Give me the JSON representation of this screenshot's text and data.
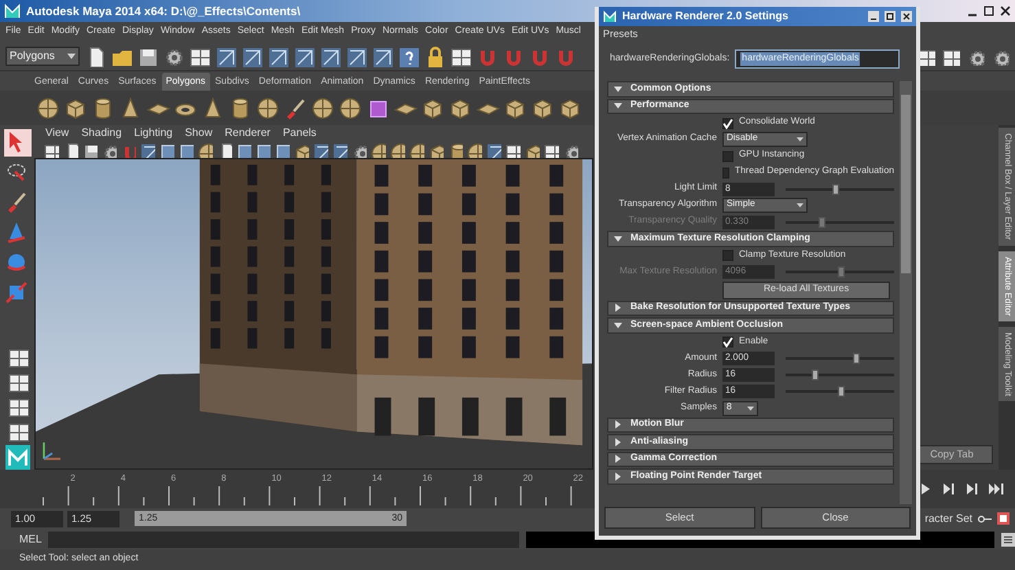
{
  "main_window": {
    "title": "Autodesk Maya 2014 x64: D:\\@_Effects\\Contents\\"
  },
  "menu_bar": [
    "File",
    "Edit",
    "Modify",
    "Create",
    "Display",
    "Window",
    "Assets",
    "Select",
    "Mesh",
    "Edit Mesh",
    "Proxy",
    "Normals",
    "Color",
    "Create UVs",
    "Edit UVs",
    "Muscl"
  ],
  "status_line": {
    "menu_set": "Polygons"
  },
  "shelf": {
    "tabs": [
      {
        "label": "General",
        "selected": false
      },
      {
        "label": "Curves",
        "selected": false
      },
      {
        "label": "Surfaces",
        "selected": false
      },
      {
        "label": "Polygons",
        "selected": true
      },
      {
        "label": "Subdivs",
        "selected": false
      },
      {
        "label": "Deformation",
        "selected": false
      },
      {
        "label": "Animation",
        "selected": false
      },
      {
        "label": "Dynamics",
        "selected": false
      },
      {
        "label": "Rendering",
        "selected": false
      },
      {
        "label": "PaintEffects",
        "selected": false
      }
    ]
  },
  "viewport_panel": {
    "menus": [
      "View",
      "Shading",
      "Lighting",
      "Show",
      "Renderer",
      "Panels"
    ]
  },
  "side_panel": {
    "tabs": [
      {
        "label": "Channel Box / Layer Editor",
        "selected": false
      },
      {
        "label": "Attribute Editor",
        "selected": true
      },
      {
        "label": "Modeling Toolkit",
        "selected": false
      }
    ],
    "copy_tab_button": "Copy Tab"
  },
  "time_slider": {
    "ticks": [
      "2",
      "4",
      "6",
      "8",
      "10",
      "12",
      "14",
      "16",
      "18",
      "20",
      "22"
    ]
  },
  "range_slider": {
    "start": "1.00",
    "playback_start": "1.25",
    "bar_start": "1.25",
    "bar_end": "30",
    "character_set_label": "racter Set"
  },
  "command_line": {
    "label": "MEL"
  },
  "help_line": "Select Tool: select an object",
  "dialog": {
    "title": "Hardware Renderer 2.0 Settings",
    "menus": [
      "Presets"
    ],
    "node_label": "hardwareRenderingGlobals:",
    "node_value": "hardwareRenderingGlobals",
    "sections": [
      {
        "title": "Common Options",
        "expanded": true
      },
      {
        "title": "Performance",
        "expanded": true,
        "rows": [
          {
            "kind": "checkbox",
            "label": "Consolidate World",
            "checked": true
          },
          {
            "kind": "dropdown",
            "label": "Vertex Animation Cache",
            "value": "Disable"
          },
          {
            "kind": "checkbox",
            "label": "GPU Instancing",
            "checked": false
          },
          {
            "kind": "checkbox",
            "label": "Thread Dependency Graph Evaluation",
            "checked": false
          },
          {
            "kind": "slider",
            "label": "Light Limit",
            "value": "8",
            "level": 0.45,
            "disabled": false
          },
          {
            "kind": "dropdown",
            "label": "Transparency Algorithm",
            "value": "Simple"
          },
          {
            "kind": "slider",
            "label": "Transparency Quality",
            "value": "0.330",
            "level": 0.33,
            "disabled": true
          }
        ]
      },
      {
        "title": "Maximum Texture Resolution Clamping",
        "expanded": true,
        "rows": [
          {
            "kind": "checkbox",
            "label": "Clamp Texture Resolution",
            "checked": false
          },
          {
            "kind": "slider",
            "label": "Max Texture Resolution",
            "value": "4096",
            "level": 0.5,
            "disabled": true
          },
          {
            "kind": "button",
            "label": "Re-load All Textures"
          }
        ]
      },
      {
        "title": "Bake Resolution for Unsupported Texture Types",
        "expanded": false
      },
      {
        "title": "Screen-space Ambient Occlusion",
        "expanded": true,
        "rows": [
          {
            "kind": "checkbox",
            "label": "Enable",
            "checked": true
          },
          {
            "kind": "slider",
            "label": "Amount",
            "value": "2.000",
            "level": 0.65,
            "disabled": false
          },
          {
            "kind": "slider",
            "label": "Radius",
            "value": "16",
            "level": 0.27,
            "disabled": false
          },
          {
            "kind": "slider",
            "label": "Filter Radius",
            "value": "16",
            "level": 0.5,
            "disabled": false
          },
          {
            "kind": "dropdown",
            "label": "Samples",
            "value": "8"
          }
        ]
      },
      {
        "title": "Motion Blur",
        "expanded": false
      },
      {
        "title": "Anti-aliasing",
        "expanded": false
      },
      {
        "title": "Gamma Correction",
        "expanded": false
      },
      {
        "title": "Floating Point Render Target",
        "expanded": false
      }
    ],
    "buttons": [
      "Select",
      "Close"
    ]
  }
}
